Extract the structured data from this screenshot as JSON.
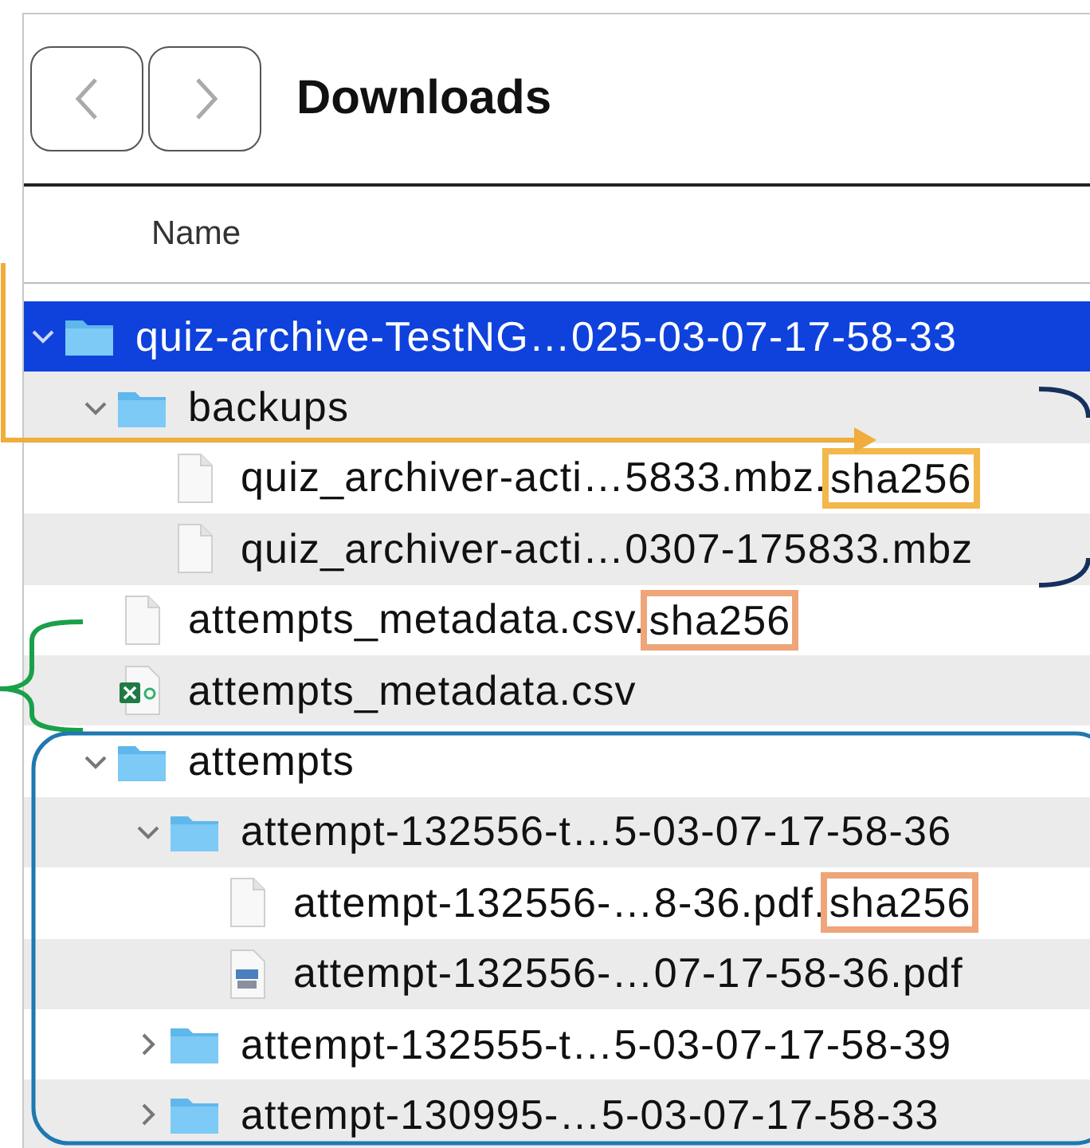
{
  "window": {
    "title": "Downloads"
  },
  "toolbar": {
    "buttons": [
      {
        "kind": "back",
        "disabled": true
      },
      {
        "kind": "forward",
        "disabled": true
      }
    ]
  },
  "columns": [
    "Name"
  ],
  "tree": [
    {
      "kind": "folder",
      "name": "quiz-archive-TestNG…025-03-07-17-58-33",
      "expanded": true,
      "selected": true,
      "children": [
        {
          "kind": "folder",
          "name": "backups",
          "expanded": true,
          "selected": false,
          "children": [
            {
              "kind": "file",
              "name": "quiz_archiver-acti…5833.mbz.",
              "tag": "sha256",
              "color": "#f2b84b",
              "selected": false
            },
            {
              "kind": "file",
              "name": "quiz_archiver-acti…0307-175833.mbz",
              "selected": false
            }
          ]
        },
        {
          "kind": "file",
          "name": "attempts_metadata.csv.",
          "tag": "sha256",
          "color": "#eea57a",
          "selected": false
        },
        {
          "kind": "spreadsheet",
          "name": "attempts_metadata.csv",
          "selected": false
        },
        {
          "kind": "folder",
          "name": "attempts",
          "expanded": true,
          "selected": false,
          "children": [
            {
              "kind": "folder",
              "name": "attempt-132556-t…5-03-07-17-58-36",
              "expanded": true,
              "selected": false,
              "children": [
                {
                  "kind": "file",
                  "name": "attempt-132556-…8-36.pdf.",
                  "tag": "sha256",
                  "color": "#eea57a",
                  "selected": false
                },
                {
                  "kind": "pdf",
                  "name": "attempt-132556-…07-17-58-36.pdf",
                  "selected": false
                }
              ]
            },
            {
              "kind": "folder",
              "name": "attempt-132555-t…5-03-07-17-58-39",
              "expanded": false,
              "selected": false
            },
            {
              "kind": "folder",
              "name": "attempt-130995-…5-03-07-17-58-33",
              "expanded": false,
              "selected": false
            }
          ]
        }
      ]
    }
  ],
  "annotations": [
    {
      "kind": "arrow",
      "color": "#f0ad3e"
    },
    {
      "kind": "bracket",
      "color": "#16305e"
    },
    {
      "kind": "brace",
      "color": "#1aa04a"
    },
    {
      "kind": "frame",
      "color": "#1f78b0"
    }
  ]
}
